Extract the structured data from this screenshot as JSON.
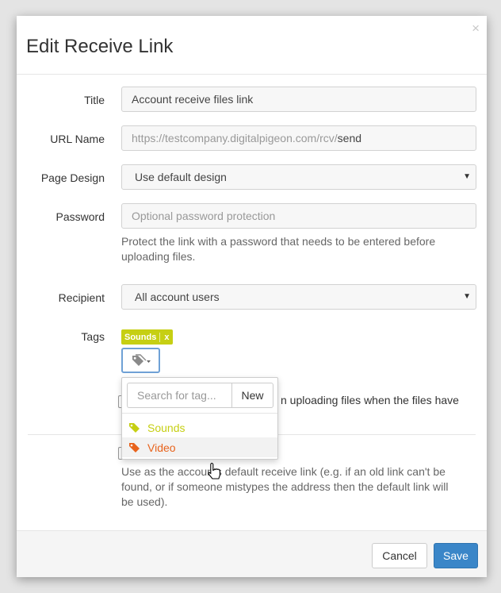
{
  "modal": {
    "title": "Edit Receive Link",
    "close_glyph": "×"
  },
  "fields": {
    "title": {
      "label": "Title",
      "value": "Account receive files link"
    },
    "url_name": {
      "label": "URL Name",
      "prefix": "https://testcompany.digitalpigeon.com/rcv/",
      "value": "send"
    },
    "page_design": {
      "label": "Page Design",
      "value": "Use default design"
    },
    "password": {
      "label": "Password",
      "placeholder": "Optional password protection",
      "help_line1": "Protect the link with a password that needs to be entered before",
      "help_line2": "uploading files."
    },
    "recipient": {
      "label": "Recipient",
      "value": "All account users"
    },
    "tags": {
      "label": "Tags",
      "selected": [
        {
          "name": "Sounds",
          "remove": "x",
          "color": "#c6cf13"
        }
      ]
    }
  },
  "tag_dropdown": {
    "search_placeholder": "Search for tag...",
    "new_label": "New",
    "items": [
      {
        "name": "Sounds",
        "color": "#c6cf13",
        "icon": "tag-icon"
      },
      {
        "name": "Video",
        "color": "#e8631c",
        "icon": "tag-icon"
      }
    ]
  },
  "partially_hidden": {
    "notify_text": "n uploading files when the files have"
  },
  "default_link": {
    "help_line1": "Use as the accounts default receive link (e.g. if an old link can't be",
    "help_line2": "found, or if someone mistypes the address then the default link will",
    "help_line3": "be used)."
  },
  "footer": {
    "cancel_label": "Cancel",
    "save_label": "Save"
  },
  "colors": {
    "primary": "#3a86c8",
    "sounds_tag": "#c6cf13",
    "video_tag": "#e8631c"
  }
}
